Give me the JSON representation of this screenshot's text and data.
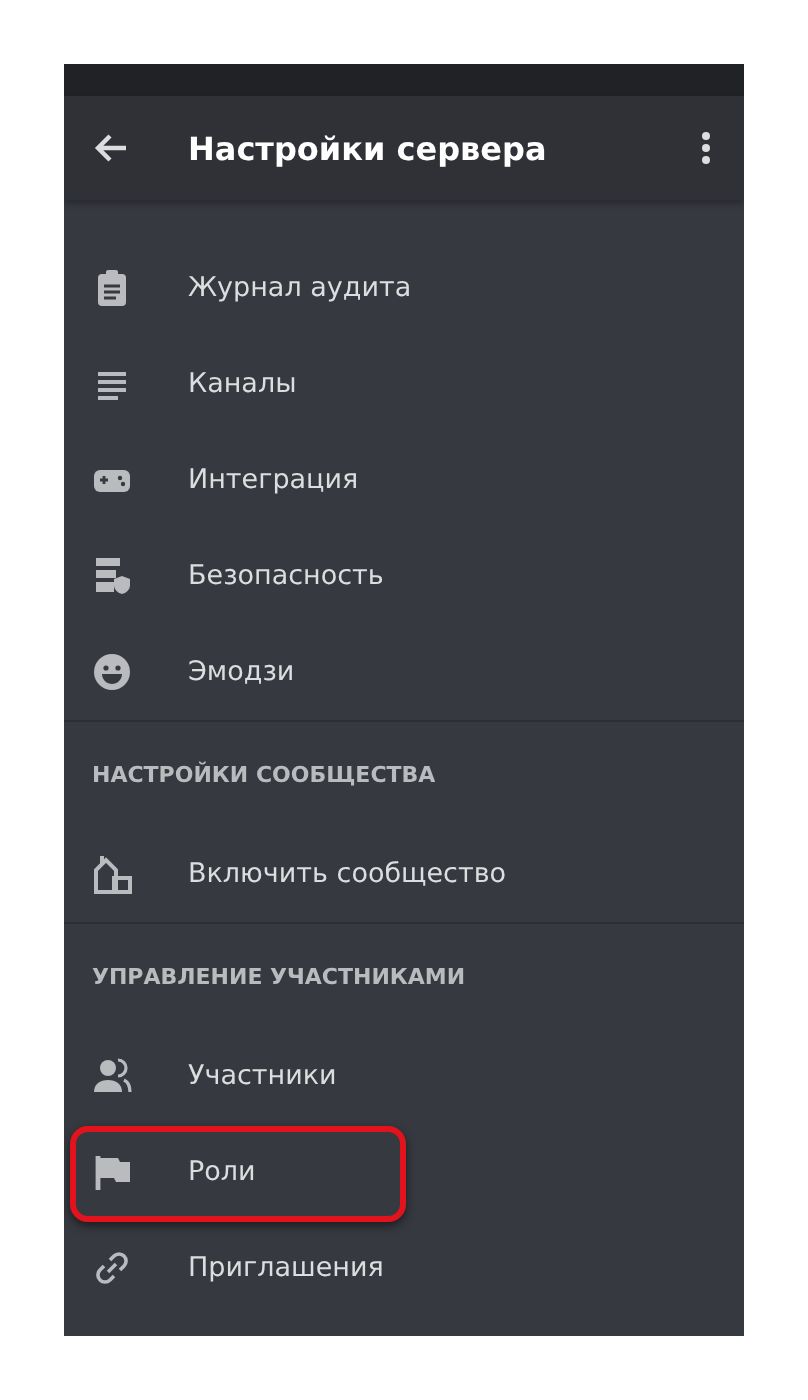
{
  "header": {
    "title": "Настройки сервера"
  },
  "sections": [
    {
      "items": [
        {
          "label": "Журнал аудита",
          "highlighted": false
        },
        {
          "label": "Каналы",
          "highlighted": false
        },
        {
          "label": "Интеграция",
          "highlighted": false
        },
        {
          "label": "Безопасность",
          "highlighted": false
        },
        {
          "label": "Эмодзи",
          "highlighted": false
        }
      ]
    },
    {
      "title": "НАСТРОЙКИ СООБЩЕСТВА",
      "items": [
        {
          "label": "Включить сообщество",
          "highlighted": false
        }
      ]
    },
    {
      "title": "УПРАВЛЕНИЕ УЧАСТНИКАМИ",
      "items": [
        {
          "label": "Участники",
          "highlighted": false
        },
        {
          "label": "Роли",
          "highlighted": true
        },
        {
          "label": "Приглашения",
          "highlighted": false
        }
      ]
    }
  ]
}
